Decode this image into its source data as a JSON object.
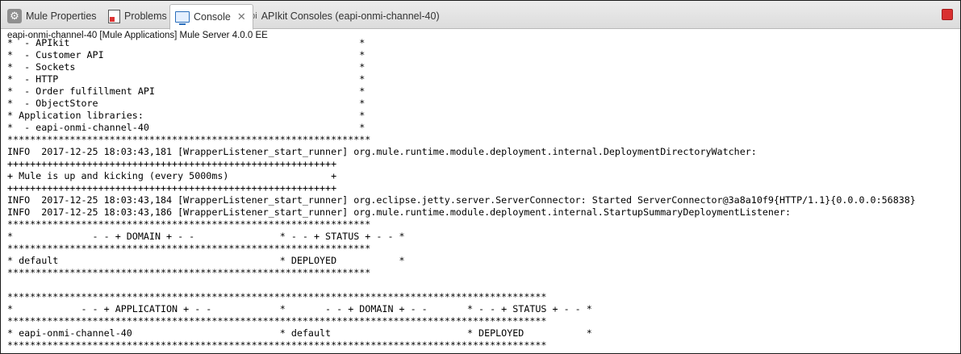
{
  "tabs": [
    {
      "label": "Mule Properties",
      "icon": "gear-icon"
    },
    {
      "label": "Problems",
      "icon": "problems-icon"
    },
    {
      "label": "Console",
      "icon": "console-icon",
      "active": true
    },
    {
      "label": "APIkit Consoles (eapi-onmi-channel-40)",
      "icon": "api-icon",
      "icon_text": "api"
    }
  ],
  "toolbar": {
    "stop_icon": "stop-icon",
    "stop_color": "#d93030"
  },
  "console": {
    "title": "eapi-onmi-channel-40 [Mule Applications] Mule Server 4.0.0 EE",
    "lines": [
      "*  - APIkit                                                   *",
      "*  - Customer API                                             *",
      "*  - Sockets                                                  *",
      "*  - HTTP                                                     *",
      "*  - Order fulfillment API                                    *",
      "*  - ObjectStore                                              *",
      "* Application libraries:                                      *",
      "*  - eapi-onmi-channel-40                                     *",
      "****************************************************************",
      "INFO  2017-12-25 18:03:43,181 [WrapperListener_start_runner] org.mule.runtime.module.deployment.internal.DeploymentDirectoryWatcher:",
      "++++++++++++++++++++++++++++++++++++++++++++++++++++++++++",
      "+ Mule is up and kicking (every 5000ms)                  +",
      "++++++++++++++++++++++++++++++++++++++++++++++++++++++++++",
      "INFO  2017-12-25 18:03:43,184 [WrapperListener_start_runner] org.eclipse.jetty.server.ServerConnector: Started ServerConnector@3a8a10f9{HTTP/1.1}{0.0.0.0:56838}",
      "INFO  2017-12-25 18:03:43,186 [WrapperListener_start_runner] org.mule.runtime.module.deployment.internal.StartupSummaryDeploymentListener:",
      "****************************************************************",
      "*              - - + DOMAIN + - -               * - - + STATUS + - - *",
      "****************************************************************",
      "* default                                       * DEPLOYED           *",
      "****************************************************************",
      "",
      "***********************************************************************************************",
      "*            - - + APPLICATION + - -            *       - - + DOMAIN + - -       * - - + STATUS + - - *",
      "***********************************************************************************************",
      "* eapi-onmi-channel-40                          * default                        * DEPLOYED           *",
      "***********************************************************************************************"
    ]
  }
}
